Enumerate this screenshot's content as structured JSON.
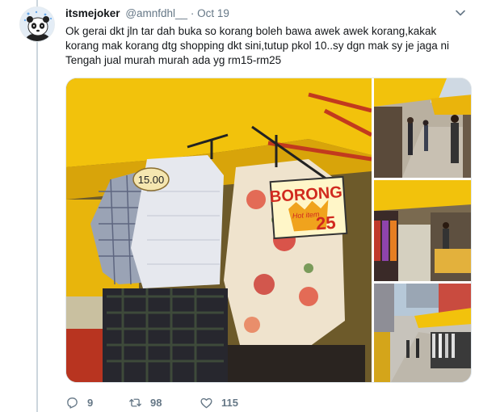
{
  "tweet": {
    "username": "itsmejoker",
    "handle": "@amnfdhl__",
    "separator": "·",
    "date": "Oct 19",
    "text": "Ok gerai dkt jln tar dah buka so korang boleh bawa awek awek korang,kakak\nkorang mak korang dtg shopping dkt sini,tutup pkol 10..sy dgn mak sy je jaga ni\nTengah jual murah murah ada yg rm15-rm25"
  },
  "media": {
    "tag_price": "15.00",
    "sign_main": "BORONG",
    "sign_sub": "Hot item",
    "sign_price": "25"
  },
  "actions": {
    "reply_count": "9",
    "retweet_count": "98",
    "like_count": "115"
  },
  "colors": {
    "canopy": "#f2c20c",
    "accent_blue": "#1da1f2",
    "muted": "#657786"
  },
  "icons": [
    "panda-avatar",
    "chevron-down-icon",
    "reply-icon",
    "retweet-icon",
    "like-icon"
  ]
}
